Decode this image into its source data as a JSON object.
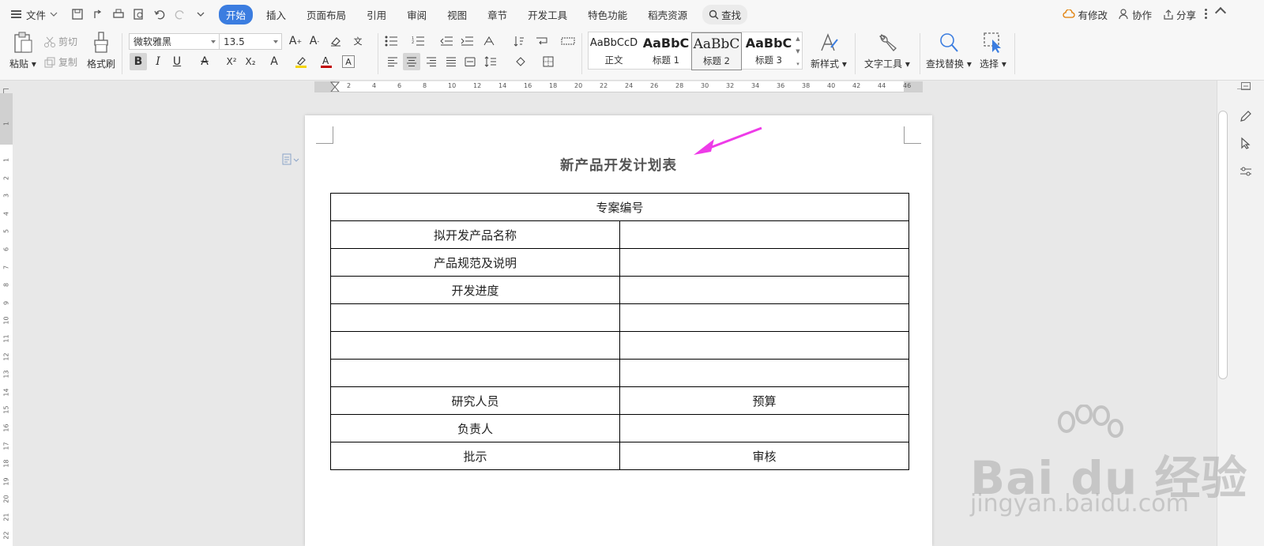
{
  "menubar": {
    "file_label": "文件",
    "tabs": [
      {
        "label": "开始",
        "active": true
      },
      {
        "label": "插入",
        "active": false
      },
      {
        "label": "页面布局",
        "active": false
      },
      {
        "label": "引用",
        "active": false
      },
      {
        "label": "审阅",
        "active": false
      },
      {
        "label": "视图",
        "active": false
      },
      {
        "label": "章节",
        "active": false
      },
      {
        "label": "开发工具",
        "active": false
      },
      {
        "label": "特色功能",
        "active": false
      },
      {
        "label": "稻壳资源",
        "active": false
      }
    ],
    "find_label": "查找",
    "right": {
      "modified_label": "有修改",
      "collab_label": "协作",
      "share_label": "分享"
    }
  },
  "ribbon": {
    "paste_label": "粘贴",
    "cut_label": "剪切",
    "copy_label": "复制",
    "format_painter_label": "格式刷",
    "font_name": "微软雅黑",
    "font_size": "13.5",
    "styles": [
      {
        "sample": "AaBbCcD",
        "name": "正文",
        "selected": false
      },
      {
        "sample": "AaBbC",
        "name": "标题 1",
        "selected": false
      },
      {
        "sample": "AaBbC",
        "name": "标题 2",
        "selected": true
      },
      {
        "sample": "AaBbC",
        "name": "标题 3",
        "selected": false
      }
    ],
    "new_style_label": "新样式",
    "text_tools_label": "文字工具",
    "find_replace_label": "查找替换",
    "select_label": "选择",
    "accent_color": "#3b7de0",
    "highlight_color": "#f5d400",
    "font_color": "#c00000"
  },
  "ruler": {
    "h_ticks": [
      "2",
      "2",
      "4",
      "6",
      "8",
      "10",
      "12",
      "14",
      "16",
      "18",
      "20",
      "22",
      "24",
      "26",
      "28",
      "30",
      "32",
      "34",
      "36",
      "38",
      "40",
      "42",
      "44",
      "46"
    ],
    "v_ticks": [
      "1",
      "1",
      "2",
      "3",
      "4",
      "5",
      "6",
      "7",
      "8",
      "9",
      "10",
      "11",
      "12",
      "13",
      "14",
      "15",
      "16",
      "17",
      "18",
      "19",
      "20",
      "21",
      "22"
    ]
  },
  "document": {
    "title": "新产品开发计划表",
    "table": {
      "header": "专案编号",
      "rows": [
        [
          "拟开发产品名称",
          ""
        ],
        [
          "产品规范及说明",
          ""
        ],
        [
          "开发进度",
          ""
        ],
        [
          "",
          ""
        ],
        [
          "",
          ""
        ],
        [
          "",
          ""
        ],
        [
          "研究人员",
          "预算"
        ],
        [
          "负责人",
          ""
        ],
        [
          "批示",
          "审核"
        ]
      ]
    },
    "arrow_color": "#ee3be8"
  },
  "watermark": {
    "main": "Bai du 经验",
    "sub": "jingyan.baidu.com"
  }
}
